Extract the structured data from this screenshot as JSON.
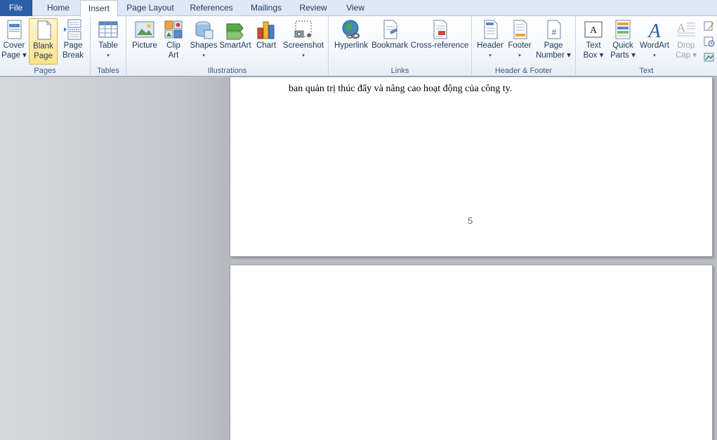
{
  "tabs": {
    "file": "File",
    "home": "Home",
    "insert": "Insert",
    "page_layout": "Page Layout",
    "references": "References",
    "mailings": "Mailings",
    "review": "Review",
    "view": "View"
  },
  "ribbon": {
    "pages": {
      "label": "Pages",
      "cover_page": [
        "Cover",
        "Page ▾"
      ],
      "blank_page": [
        "Blank",
        "Page"
      ],
      "page_break": [
        "Page",
        "Break"
      ]
    },
    "tables": {
      "label": "Tables",
      "table": [
        "Table",
        "▾"
      ]
    },
    "illustrations": {
      "label": "Illustrations",
      "picture": "Picture",
      "clip_art": [
        "Clip",
        "Art"
      ],
      "shapes": [
        "Shapes",
        "▾"
      ],
      "smartart": "SmartArt",
      "chart": "Chart",
      "screenshot": [
        "Screenshot",
        "▾"
      ]
    },
    "links": {
      "label": "Links",
      "hyperlink": "Hyperlink",
      "bookmark": "Bookmark",
      "cross_reference": "Cross-reference"
    },
    "header_footer": {
      "label": "Header & Footer",
      "header": [
        "Header",
        "▾"
      ],
      "footer": [
        "Footer",
        "▾"
      ],
      "page_number": [
        "Page",
        "Number ▾"
      ]
    },
    "text": {
      "label": "Text",
      "text_box": [
        "Text",
        "Box ▾"
      ],
      "quick_parts": [
        "Quick",
        "Parts ▾"
      ],
      "wordart": [
        "WordArt",
        "▾"
      ],
      "drop_cap": [
        "Drop",
        "Cap ▾"
      ]
    }
  },
  "document": {
    "line": "ban quản trị thúc đẩy và nâng cao hoạt động của công ty.",
    "page_number": "5"
  },
  "colors": {
    "file_tab": "#2a5fa8",
    "ribbon_bg": "#f4f7fb",
    "selected": "#ffe28a"
  }
}
